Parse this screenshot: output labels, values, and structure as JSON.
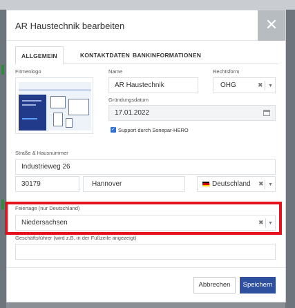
{
  "modal": {
    "title": "AR Haustechnik bearbeiten",
    "close_symbol": "✕"
  },
  "tabs": [
    {
      "label": "ALLGEMEIN",
      "active": true
    },
    {
      "label": "KONTAKTDATEN",
      "active": false
    },
    {
      "label": "BANKINFORMATIONEN",
      "active": false
    }
  ],
  "logo": {
    "label": "Firmenlogo"
  },
  "name": {
    "label": "Name",
    "value": "AR Haustechnik"
  },
  "rechtsform": {
    "label": "Rechtsform",
    "value": "OHG"
  },
  "gruendung": {
    "label": "Gründungsdatum",
    "value": "17.01.2022",
    "icon": "calendar-icon"
  },
  "support": {
    "label": "Support durch Sonepar-HERO",
    "checked": true
  },
  "address": {
    "label": "Straße & Hausnummer",
    "street": "Industrieweg 26",
    "zip": "30179",
    "city": "Hannover",
    "country": "Deutschland"
  },
  "feiertage": {
    "label": "Feiertage (nur Deutschland)",
    "value": "Niedersachsen"
  },
  "geschaeftsfuehrer": {
    "label": "Geschäftsführer (wird z.B. in der Fußzeile angezeigt)",
    "value": ""
  },
  "footer": {
    "cancel_label": "Abbrechen",
    "save_label": "Speichern"
  },
  "colors": {
    "accent": "#2f4f9f",
    "highlight": "#e3121d",
    "checkbox": "#2f6fd1"
  },
  "symbols": {
    "clear": "✖",
    "caret": "▼",
    "check": "✓"
  }
}
